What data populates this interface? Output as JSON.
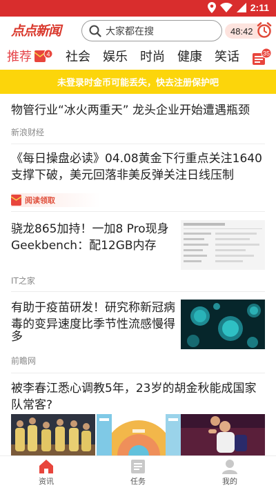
{
  "status_bar": {
    "time": "2:11"
  },
  "header": {
    "logo": "点点新闻",
    "search_placeholder": "大家都在搜",
    "timer": "48:42"
  },
  "tabs": [
    {
      "label": "推荐",
      "active": true,
      "badge": "4"
    },
    {
      "label": "社会"
    },
    {
      "label": "娱乐"
    },
    {
      "label": "时尚"
    },
    {
      "label": "健康"
    },
    {
      "label": "笑话"
    }
  ],
  "menu_badge": "35",
  "notice": "未登录时金币可能丢失，快去注册保护吧",
  "feed": {
    "item1": {
      "title": "物管行业“冰火两重天” 龙头企业开始遭遇瓶颈",
      "source": "新浪财经"
    },
    "item2": {
      "title_line1": "《每日操盘必读》04.08黄金下行重点关注1640",
      "title_line2": "支撑下破，美元回落非美反弹关注日线压制",
      "reward": "阅读领取"
    },
    "item3": {
      "title_line1": "骁龙865加持！一加8 Pro现身",
      "title_line2": "Geekbench：配12GB内存",
      "source": "IT之家"
    },
    "item4": {
      "title_line1": "有助于疫苗研发！研究称新冠病",
      "title_line2": "毒的变异速度比季节性流感慢得",
      "title_line3": "多",
      "source": "前瞻网"
    },
    "item5": {
      "title_line1": "被李春江悉心调教5年，23岁的胡金秋能成国家",
      "title_line2": "队常客?"
    }
  },
  "bottom_nav": [
    {
      "label": "资讯",
      "icon": "home-icon"
    },
    {
      "label": "任务",
      "icon": "task-icon"
    },
    {
      "label": "我的",
      "icon": "profile-icon"
    }
  ],
  "colors": {
    "brand": "#d92d2d",
    "accent": "#e5454a",
    "notice": "#fcd50b"
  }
}
